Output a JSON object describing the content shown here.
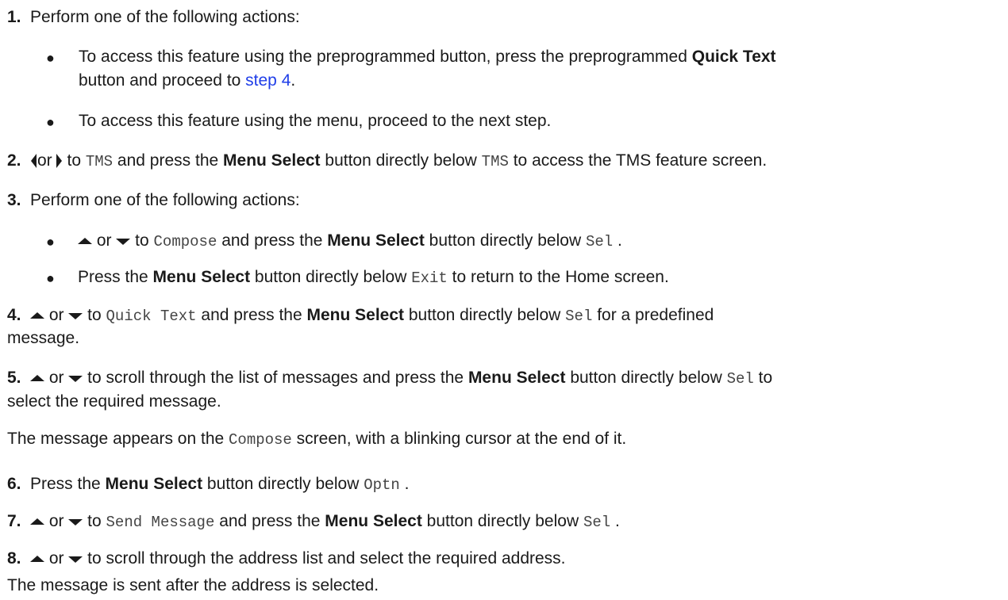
{
  "steps": {
    "s1": {
      "num": "1.",
      "text": "Perform one of the following actions:",
      "b1_pre": "To access this feature using the preprogrammed button, press the preprogrammed ",
      "b1_bold": "Quick Text",
      "b1_cont_pre": "button and proceed to ",
      "b1_link": "step 4",
      "b1_cont_post": ".",
      "b2": "To access this feature using the menu, proceed to the next step."
    },
    "s2": {
      "num": "2.",
      "or": "or",
      "t1": " to ",
      "m1": "TMS",
      "t2": " and press the ",
      "bold": "Menu Select",
      "t3": " button directly below ",
      "m2": "TMS",
      "t4": " to access the TMS feature screen."
    },
    "s3": {
      "num": "3.",
      "text": "Perform one of the following actions:",
      "b1_or": " or ",
      "b1_t1": " to ",
      "b1_m1": "Compose",
      "b1_t2": " and press the ",
      "b1_bold": "Menu Select",
      "b1_t3": " button directly below ",
      "b1_m2": "Sel",
      "b1_t4": " .",
      "b2_t1": "Press the ",
      "b2_bold": "Menu Select",
      "b2_t2": " button directly below ",
      "b2_m": "Exit",
      "b2_t3": " to return to the Home screen."
    },
    "s4": {
      "num": "4.",
      "or": " or ",
      "t1": " to ",
      "m1": "Quick Text",
      "t2": " and press the ",
      "bold": "Menu Select",
      "t3": " button directly below ",
      "m2": "Sel",
      "t4": " for a predefined",
      "cont": "message."
    },
    "s5": {
      "num": "5.",
      "or": " or ",
      "t1": " to scroll through the list of messages and press the ",
      "bold": "Menu Select",
      "t2": " button directly below ",
      "m": "Sel",
      "t3": " to",
      "cont": "select the required message.",
      "r1": "The message appears on the ",
      "rm": "Compose",
      "r2": " screen, with a blinking cursor at the end of it."
    },
    "s6": {
      "num": "6.",
      "t1": "Press the ",
      "bold": "Menu Select",
      "t2": " button directly below ",
      "m": "Optn",
      "t3": " ."
    },
    "s7": {
      "num": "7.",
      "or": " or ",
      "t1": " to ",
      "m1": "Send Message",
      "t2": " and press the ",
      "bold": "Menu Select",
      "t3": " button directly below ",
      "m2": "Sel",
      "t4": " ."
    },
    "s8": {
      "num": "8.",
      "or": " or ",
      "t1": " to scroll through the address list and select the required address.",
      "result": "The message is sent after the address is selected."
    }
  },
  "icons": {
    "left": "left-arrow-icon",
    "right": "right-arrow-icon",
    "up": "up-arrow-icon",
    "down": "down-arrow-icon"
  }
}
